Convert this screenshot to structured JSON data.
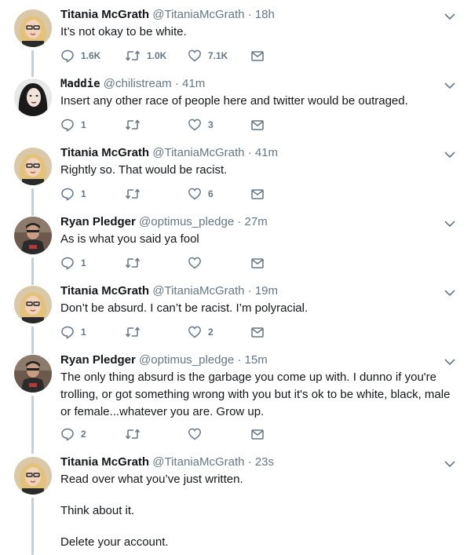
{
  "tweets": [
    {
      "name": "Titania McGrath",
      "handle": "@TitaniaMcGrath",
      "separator": "·",
      "time": "18h",
      "lines": [
        "It’s not okay to be white."
      ],
      "replies": "1.6K",
      "retweets": "1.0K",
      "likes": "7.1K",
      "avatar": "titania"
    },
    {
      "name": "Maddie",
      "handle": "@chilistream",
      "separator": "·",
      "time": "41m",
      "lines": [
        "Insert any other race of people here and twitter would be outraged."
      ],
      "replies": "1",
      "retweets": "",
      "likes": "3",
      "avatar": "maddie"
    },
    {
      "name": "Titania McGrath",
      "handle": "@TitaniaMcGrath",
      "separator": "·",
      "time": "41m",
      "lines": [
        "Rightly so. That would be racist."
      ],
      "replies": "1",
      "retweets": "",
      "likes": "6",
      "avatar": "titania"
    },
    {
      "name": "Ryan Pledger",
      "handle": "@optimus_pledge",
      "separator": "·",
      "time": "27m",
      "lines": [
        "As is what you said ya fool"
      ],
      "replies": "1",
      "retweets": "",
      "likes": "",
      "avatar": "ryan"
    },
    {
      "name": "Titania McGrath",
      "handle": "@TitaniaMcGrath",
      "separator": "·",
      "time": "19m",
      "lines": [
        "Don’t be absurd. I can’t be racist. I’m polyracial."
      ],
      "replies": "1",
      "retweets": "",
      "likes": "2",
      "avatar": "titania"
    },
    {
      "name": "Ryan Pledger",
      "handle": "@optimus_pledge",
      "separator": "·",
      "time": "15m",
      "lines": [
        "The only thing absurd is the garbage you come up with. I dunno if you're trolling, or got something wrong with you but it's ok to be white, black, male or female...whatever you are. Grow up."
      ],
      "replies": "2",
      "retweets": "",
      "likes": "",
      "avatar": "ryan"
    },
    {
      "name": "Titania McGrath",
      "handle": "@TitaniaMcGrath",
      "separator": "·",
      "time": "23s",
      "lines": [
        "Read over what you’ve just written.",
        "Think about it.",
        "Delete your account."
      ],
      "replies": "",
      "retweets": "",
      "likes": "",
      "avatar": "titania"
    }
  ],
  "colors": {
    "thread_line": "#c4cfd6",
    "secondary_text": "#657786",
    "primary_text": "#14171a"
  },
  "icons": {
    "reply": "reply-icon",
    "retweet": "retweet-icon",
    "like": "heart-icon",
    "dm": "envelope-icon",
    "menu": "chevron-down-icon"
  }
}
